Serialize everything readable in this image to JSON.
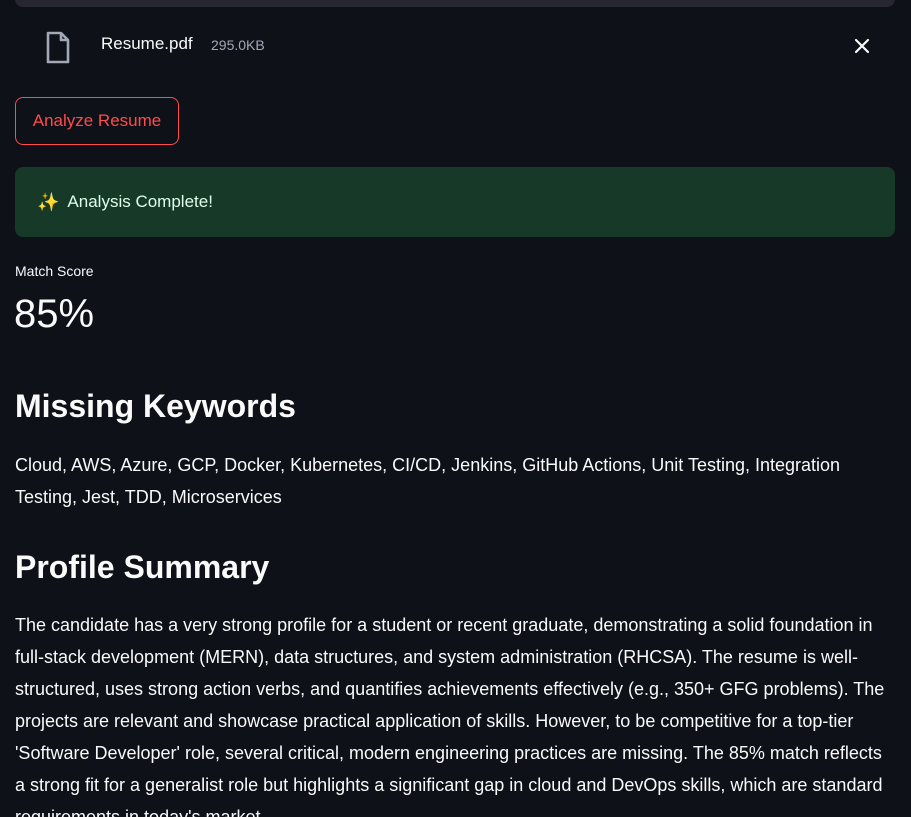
{
  "uploaded_file": {
    "name": "Resume.pdf",
    "size": "295.0KB",
    "file_icon": "file-icon",
    "remove_icon": "close-icon"
  },
  "actions": {
    "analyze_label": "Analyze Resume"
  },
  "status": {
    "icon": "✨",
    "message": "Analysis Complete!"
  },
  "metric": {
    "label": "Match Score",
    "value": "85%"
  },
  "missing_keywords": {
    "heading": "Missing Keywords",
    "text": "Cloud, AWS, Azure, GCP, Docker, Kubernetes, CI/CD, Jenkins, GitHub Actions, Unit Testing, Integration Testing, Jest, TDD, Microservices"
  },
  "profile_summary": {
    "heading": "Profile Summary",
    "text": "The candidate has a very strong profile for a student or recent graduate, demonstrating a solid foundation in full-stack development (MERN), data structures, and system administration (RHCSA). The resume is well-structured, uses strong action verbs, and quantifies achievements effectively (e.g., 350+ GFG problems). The projects are relevant and showcase practical application of skills. However, to be competitive for a top-tier 'Software Developer' role, several critical, modern engineering practices are missing. The 85% match reflects a strong fit for a generalist role but highlights a significant gap in cloud and DevOps skills, which are standard requirements in today's market."
  },
  "colors": {
    "background": "#0e1117",
    "accent": "#ff4b4b",
    "success_bg": "#173928",
    "success_text": "#dffde9"
  }
}
